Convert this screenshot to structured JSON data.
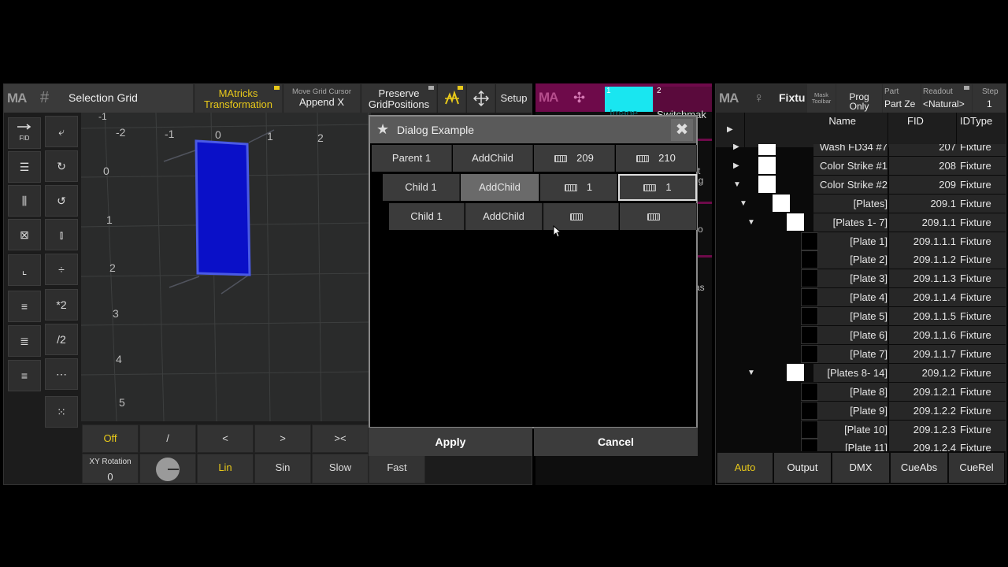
{
  "left_window": {
    "logo": "MA",
    "title": "Selection Grid",
    "matricks_line1": "MAtricks",
    "matricks_line2": "Transformation",
    "move_small": "Move Grid Cursor",
    "move_main": "Append X",
    "preserve_line1": "Preserve",
    "preserve_line2": "GridPositions",
    "setup": "Setup",
    "x_axis": [
      "-1",
      "-2",
      "-1",
      "0",
      "1",
      "2"
    ],
    "y_axis": [
      "0",
      "1",
      "2",
      "3",
      "4",
      "5"
    ],
    "tools_left": [
      "FID",
      "",
      "",
      "",
      "",
      "",
      "",
      ""
    ],
    "tools_right": [
      "",
      "",
      "",
      "",
      "",
      "*2",
      "/2",
      "",
      ""
    ],
    "bottom_row1": [
      "Off",
      "/",
      "<",
      ">",
      "><"
    ],
    "bottom_row2_label": "XY Rotation",
    "bottom_row2_value": "0",
    "bottom_row2": [
      "Lin",
      "Sin",
      "Slow",
      "Fast"
    ],
    "accent_yellow": "#e8c91a",
    "grid_square_color": "#0a10c8"
  },
  "dialog": {
    "title": "Dialog Example",
    "row1": {
      "label": "Parent 1",
      "action": "AddChild",
      "v1": "209",
      "v2": "210"
    },
    "row2": {
      "label": "Child 1",
      "action": "AddChild",
      "v1": "1",
      "v2": "1"
    },
    "row3": {
      "label": "Child 1",
      "action": "AddChild",
      "v1": "",
      "v2": ""
    },
    "apply": "Apply",
    "cancel": "Cancel"
  },
  "middle_window": {
    "logo": "MA",
    "tab1_num": "1",
    "tab1_label": "Image",
    "tab2_num": "2",
    "tab2_label": "Switchmak",
    "accent_cyan": "#19e6f0",
    "accent_magenta": "#6e0a4a",
    "edge_bits": [
      "st",
      "ng",
      "o",
      "as"
    ]
  },
  "right_window": {
    "logo": "MA",
    "title": "Fixtu",
    "mask_toolbar": "Mask Toolbar",
    "prog_line1": "Prog",
    "prog_line2": "Only",
    "part_small": "Part",
    "part_main": "Part Ze",
    "readout_small": "Readout",
    "readout_main": "<Natural>",
    "step_small": "Step",
    "step_main": "1",
    "col_name": "Name",
    "col_fid": "FID",
    "col_type": "IDType",
    "rows": [
      {
        "name": "Wash FD34 #7",
        "fid": "207",
        "type": "Fixture"
      },
      {
        "name": "Color Strike #1",
        "fid": "208",
        "type": "Fixture"
      },
      {
        "name": "Color Strike #2",
        "fid": "209",
        "type": "Fixture"
      },
      {
        "name": "[Plates]",
        "fid": "209.1",
        "type": "Fixture"
      },
      {
        "name": "[Plates 1- 7]",
        "fid": "209.1.1",
        "type": "Fixture"
      },
      {
        "name": "[Plate 1]",
        "fid": "209.1.1.1",
        "type": "Fixture"
      },
      {
        "name": "[Plate 2]",
        "fid": "209.1.1.2",
        "type": "Fixture"
      },
      {
        "name": "[Plate 3]",
        "fid": "209.1.1.3",
        "type": "Fixture"
      },
      {
        "name": "[Plate 4]",
        "fid": "209.1.1.4",
        "type": "Fixture"
      },
      {
        "name": "[Plate 5]",
        "fid": "209.1.1.5",
        "type": "Fixture"
      },
      {
        "name": "[Plate 6]",
        "fid": "209.1.1.6",
        "type": "Fixture"
      },
      {
        "name": "[Plate 7]",
        "fid": "209.1.1.7",
        "type": "Fixture"
      },
      {
        "name": "[Plates 8- 14]",
        "fid": "209.1.2",
        "type": "Fixture"
      },
      {
        "name": "[Plate 8]",
        "fid": "209.1.2.1",
        "type": "Fixture"
      },
      {
        "name": "[Plate 9]",
        "fid": "209.1.2.2",
        "type": "Fixture"
      },
      {
        "name": "[Plate 10]",
        "fid": "209.1.2.3",
        "type": "Fixture"
      },
      {
        "name": "[Plate 11]",
        "fid": "209.1.2.4",
        "type": "Fixture"
      }
    ],
    "bottom_tabs": [
      "Auto",
      "Output",
      "DMX",
      "CueAbs",
      "CueRel"
    ]
  }
}
